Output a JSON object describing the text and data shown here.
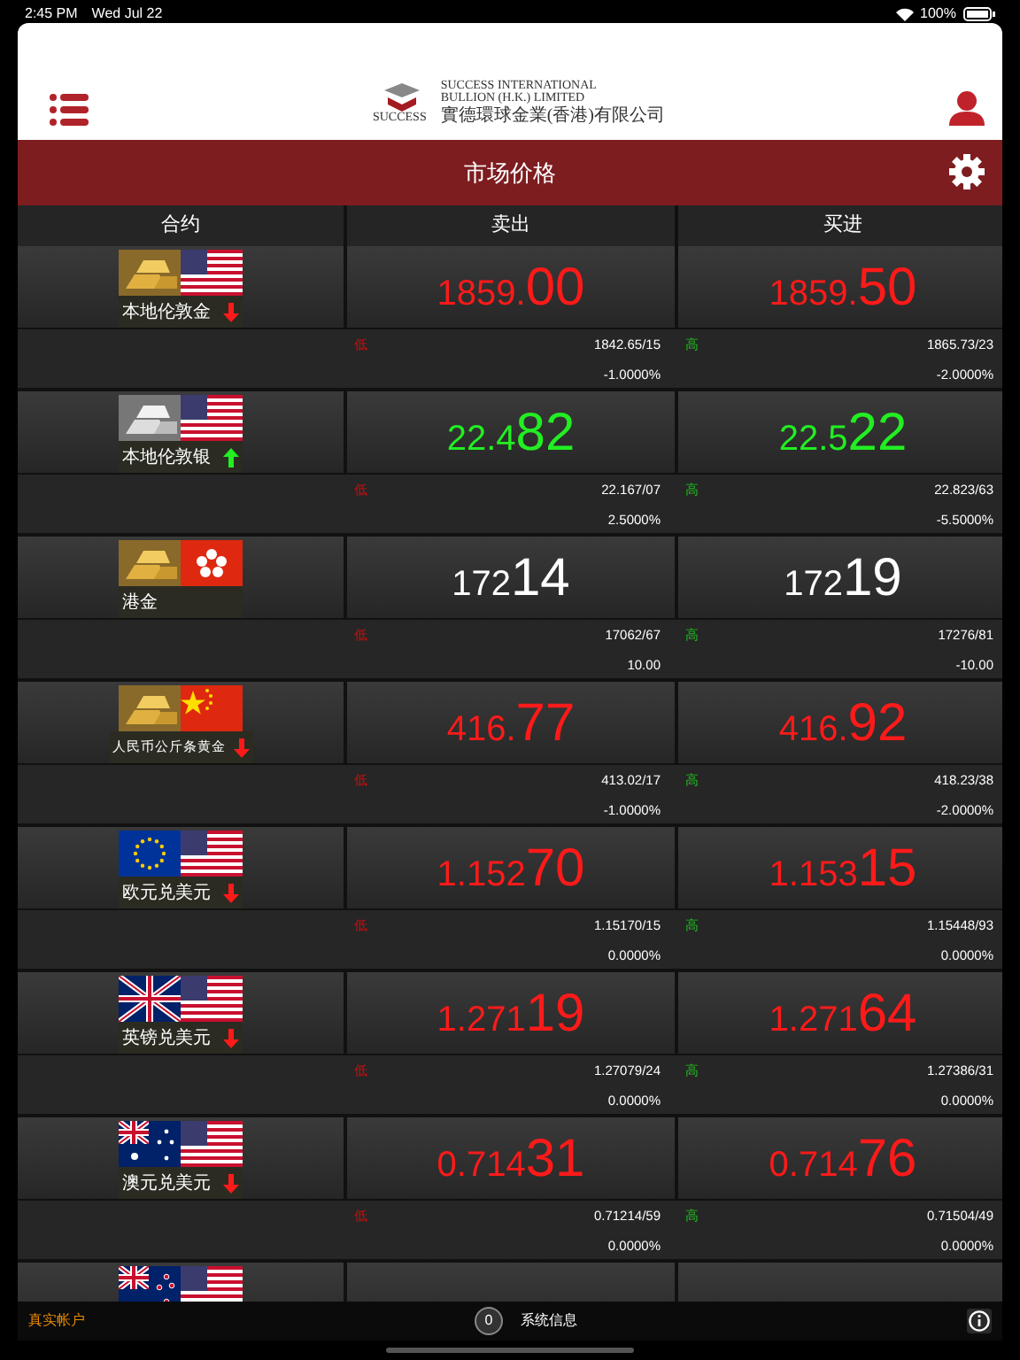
{
  "status_bar": {
    "time": "2:45 PM",
    "date": "Wed Jul 22",
    "battery": "100%"
  },
  "header": {
    "logo_word": "SUCCESS",
    "company_lines": [
      "SUCCESS INTERNATIONAL",
      "BULLION (H.K.) LIMITED",
      "實德環球金業(香港)有限公司"
    ]
  },
  "title": "市场价格",
  "columns": [
    "合约",
    "卖出",
    "买进"
  ],
  "rows": [
    {
      "name": "本地伦敦金",
      "icons": [
        {
          "kind": "gold"
        },
        {
          "kind": "us"
        }
      ],
      "rising": false,
      "falling": true,
      "sell": [
        "1859.",
        "00"
      ],
      "buy": [
        "1859.",
        "50"
      ],
      "low_label": "低",
      "low": "1842.65/15",
      "low_change": "-1.0000%",
      "high_label": "高",
      "high": "1865.73/23",
      "high_change": "-2.0000%"
    },
    {
      "name": "本地伦敦银",
      "icons": [
        {
          "kind": "silver"
        },
        {
          "kind": "us"
        }
      ],
      "rising": true,
      "falling": false,
      "sell": [
        "22.4",
        "82"
      ],
      "buy": [
        "22.5",
        "22"
      ],
      "low_label": "低",
      "low": "22.167/07",
      "low_change": "2.5000%",
      "high_label": "高",
      "high": "22.823/63",
      "high_change": "-5.5000%"
    },
    {
      "name": "港金",
      "icons": [
        {
          "kind": "gold"
        },
        {
          "kind": "hk"
        }
      ],
      "rising": false,
      "falling": false,
      "sell": [
        "172",
        "14"
      ],
      "buy": [
        "172",
        "19"
      ],
      "low_label": "低",
      "low": "17062/67",
      "low_change": "10.00",
      "high_label": "高",
      "high": "17276/81",
      "high_change": "-10.00"
    },
    {
      "name": "人民币公斤条黄金",
      "icons": [
        {
          "kind": "gold"
        },
        {
          "kind": "cn"
        }
      ],
      "rising": false,
      "falling": true,
      "sell": [
        "416.",
        "77"
      ],
      "buy": [
        "416.",
        "92"
      ],
      "low_label": "低",
      "low": "413.02/17",
      "low_change": "-1.0000%",
      "high_label": "高",
      "high": "418.23/38",
      "high_change": "-2.0000%"
    },
    {
      "name": "欧元兑美元",
      "icons": [
        {
          "kind": "eu"
        },
        {
          "kind": "us"
        }
      ],
      "rising": false,
      "falling": true,
      "sell": [
        "1.152",
        "70"
      ],
      "buy": [
        "1.153",
        "15"
      ],
      "low_label": "低",
      "low": "1.15170/15",
      "low_change": "0.0000%",
      "high_label": "高",
      "high": "1.15448/93",
      "high_change": "0.0000%"
    },
    {
      "name": "英镑兑美元",
      "icons": [
        {
          "kind": "gb"
        },
        {
          "kind": "us"
        }
      ],
      "rising": false,
      "falling": true,
      "sell": [
        "1.271",
        "19"
      ],
      "buy": [
        "1.271",
        "64"
      ],
      "low_label": "低",
      "low": "1.27079/24",
      "low_change": "0.0000%",
      "high_label": "高",
      "high": "1.27386/31",
      "high_change": "0.0000%"
    },
    {
      "name": "澳元兑美元",
      "icons": [
        {
          "kind": "au"
        },
        {
          "kind": "us"
        }
      ],
      "rising": false,
      "falling": true,
      "sell": [
        "0.714",
        "31"
      ],
      "buy": [
        "0.714",
        "76"
      ],
      "low_label": "低",
      "low": "0.71214/59",
      "low_change": "0.0000%",
      "high_label": "高",
      "high": "0.71504/49",
      "high_change": "0.0000%"
    },
    {
      "icons": [
        {
          "kind": "nz"
        },
        {
          "kind": "us"
        }
      ]
    }
  ],
  "footer": {
    "account": "真实帐户",
    "count": "0",
    "message": "系统信息"
  }
}
